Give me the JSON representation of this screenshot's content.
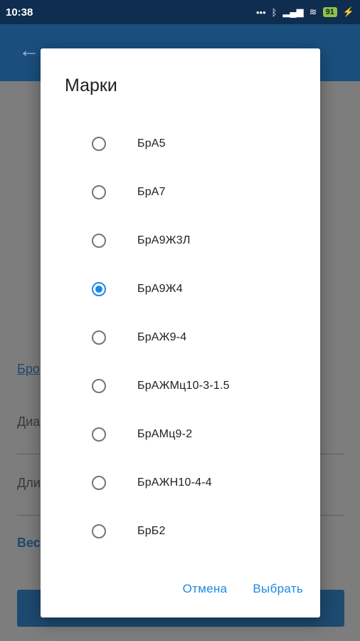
{
  "status_bar": {
    "time": "10:38",
    "dots": "•••",
    "bluetooth": "ᛒ",
    "signal": "▂▄▆",
    "wifi": "≋",
    "battery": "91",
    "charging": "⚡"
  },
  "app_bar": {
    "back_icon": "←"
  },
  "background": {
    "link_text": "Бро",
    "field1": "Диа",
    "field2": "Дли",
    "total": "Вес"
  },
  "dialog": {
    "title": "Марки",
    "options": [
      {
        "label": "БрА5",
        "checked": false
      },
      {
        "label": "БрА7",
        "checked": false
      },
      {
        "label": "БрА9Ж3Л",
        "checked": false
      },
      {
        "label": "БрА9Ж4",
        "checked": true
      },
      {
        "label": "БрАЖ9-4",
        "checked": false
      },
      {
        "label": "БрАЖМц10-3-1.5",
        "checked": false
      },
      {
        "label": "БрАМц9-2",
        "checked": false
      },
      {
        "label": "БрАЖН10-4-4",
        "checked": false
      },
      {
        "label": "БрБ2",
        "checked": false
      }
    ],
    "cancel_label": "Отмена",
    "select_label": "Выбрать"
  },
  "colors": {
    "accent": "#1e88e5",
    "status_bar": "#0f2d4f",
    "app_bar": "#1a4f7d"
  }
}
